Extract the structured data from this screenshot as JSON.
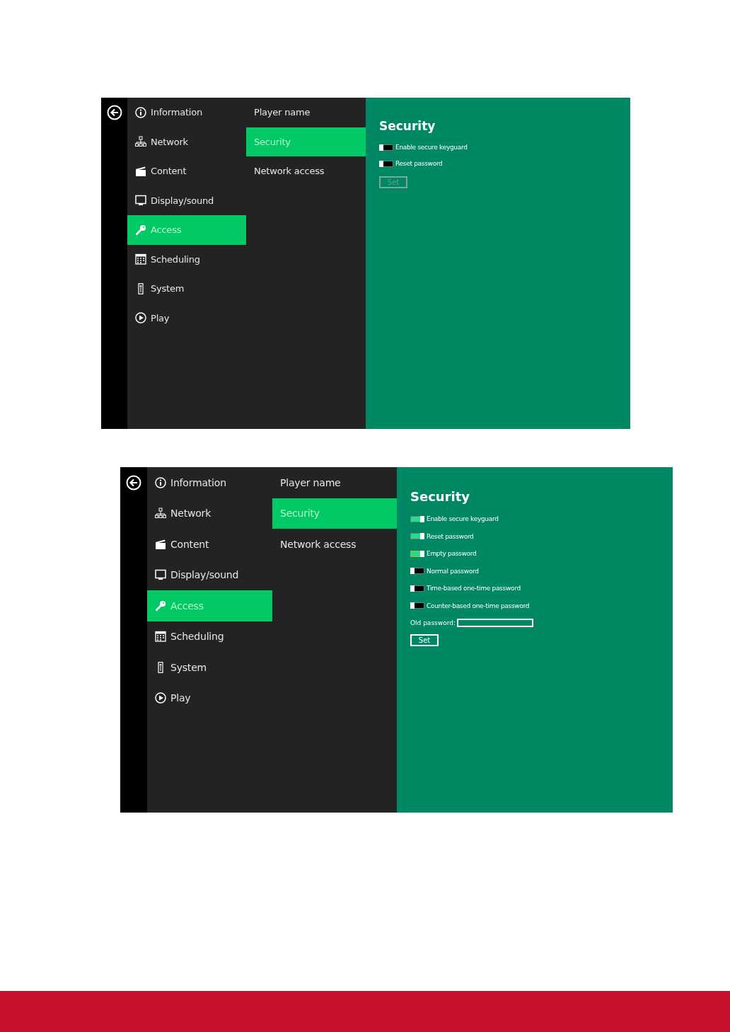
{
  "screens": [
    {
      "menu": [
        {
          "label": "Information",
          "selected": false
        },
        {
          "label": "Network",
          "selected": false
        },
        {
          "label": "Content",
          "selected": false
        },
        {
          "label": "Display/sound",
          "selected": false
        },
        {
          "label": "Access",
          "selected": true
        },
        {
          "label": "Scheduling",
          "selected": false
        },
        {
          "label": "System",
          "selected": false
        },
        {
          "label": "Play",
          "selected": false
        }
      ],
      "submenu": [
        {
          "label": "Player name",
          "selected": false
        },
        {
          "label": "Security",
          "selected": true
        },
        {
          "label": "Network access",
          "selected": false
        }
      ],
      "title": "Security",
      "toggles": [
        {
          "label": "Enable secure keyguard",
          "on": false,
          "focused": false
        },
        {
          "label": "Reset password",
          "on": false,
          "focused": false
        }
      ],
      "set_button": {
        "label": "Set",
        "disabled": true
      }
    },
    {
      "menu": [
        {
          "label": "Information",
          "selected": false
        },
        {
          "label": "Network",
          "selected": false
        },
        {
          "label": "Content",
          "selected": false
        },
        {
          "label": "Display/sound",
          "selected": false
        },
        {
          "label": "Access",
          "selected": true
        },
        {
          "label": "Scheduling",
          "selected": false
        },
        {
          "label": "System",
          "selected": false
        },
        {
          "label": "Play",
          "selected": false
        }
      ],
      "submenu": [
        {
          "label": "Player name",
          "selected": false
        },
        {
          "label": "Security",
          "selected": true
        },
        {
          "label": "Network access",
          "selected": false
        }
      ],
      "title": "Security",
      "toggles": [
        {
          "label": "Enable secure keyguard",
          "on": true,
          "focused": false
        },
        {
          "label": "Reset password",
          "on": true,
          "focused": false
        },
        {
          "label": "Empty password",
          "on": true,
          "focused": true
        },
        {
          "label": "Normal password",
          "on": false,
          "focused": false
        },
        {
          "label": "Time-based one-time password",
          "on": false,
          "focused": false
        },
        {
          "label": "Counter-based one-time password",
          "on": false,
          "focused": false
        }
      ],
      "password_field": {
        "label": "Old password:"
      },
      "set_button": {
        "label": "Set",
        "disabled": false
      }
    }
  ]
}
